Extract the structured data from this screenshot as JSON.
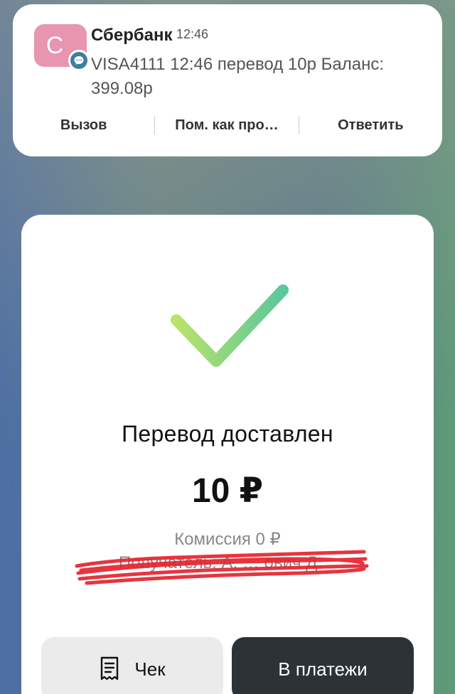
{
  "notification": {
    "avatar_letter": "С",
    "app": "Сбербанк",
    "time": "12:46",
    "message": "VISA4111 12:46 перевод 10р Баланс: 399.08р",
    "actions": {
      "call": "Вызов",
      "mark_read": "Пом. как про…",
      "reply": "Ответить"
    }
  },
  "transfer": {
    "status": "Перевод доставлен",
    "amount": "10 ₽",
    "fee": "Комиссия 0 ₽",
    "recipient": "Получатель: А. … ович Д.",
    "buttons": {
      "receipt": "Чек",
      "payments": "В платежи"
    }
  },
  "colors": {
    "avatar": "#e895b0",
    "badge": "#3f7ea0",
    "check_start": "#b9e36a",
    "check_end": "#5cc79a",
    "scribble": "#e5232e",
    "dark_button": "#2c3236"
  }
}
